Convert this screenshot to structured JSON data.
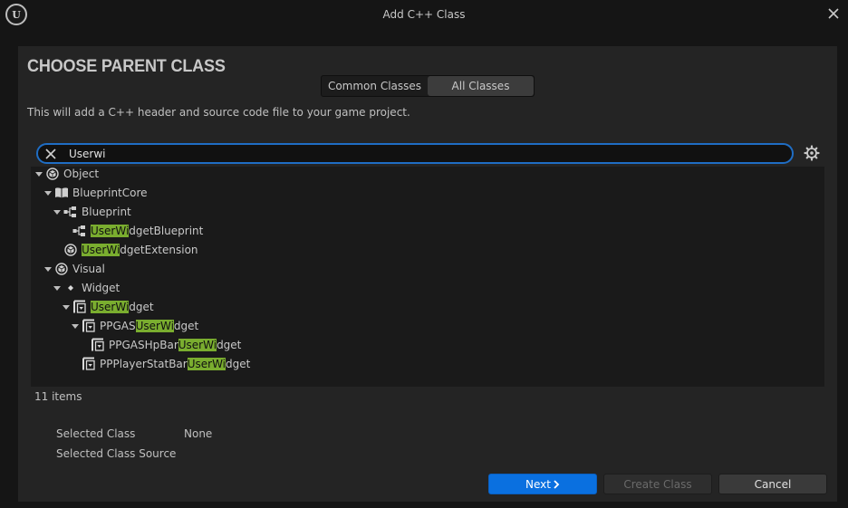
{
  "window": {
    "title": "Add C++ Class",
    "logo_text": "U"
  },
  "header": {
    "title": "CHOOSE PARENT CLASS"
  },
  "tabs": [
    {
      "label": "Common Classes",
      "selected": false
    },
    {
      "label": "All Classes",
      "selected": true
    }
  ],
  "description": "This will add a C++ header and source code file to your game project.",
  "search": {
    "value": "Userwi"
  },
  "tree": [
    {
      "pre": "Object",
      "match": "",
      "post": "",
      "icon": "object-icon",
      "expanded": true
    },
    {
      "pre": "BlueprintCore",
      "match": "",
      "post": "",
      "icon": "book-icon",
      "expanded": true
    },
    {
      "pre": "Blueprint",
      "match": "",
      "post": "",
      "icon": "blueprint-icon",
      "expanded": true
    },
    {
      "pre": "",
      "match": "UserWi",
      "post": "dgetBlueprint",
      "icon": "blueprint-icon",
      "expanded": null
    },
    {
      "pre": "",
      "match": "UserWi",
      "post": "dgetExtension",
      "icon": "object-icon",
      "expanded": null
    },
    {
      "pre": "Visual",
      "match": "",
      "post": "",
      "icon": "object-icon",
      "expanded": true
    },
    {
      "pre": "Widget",
      "match": "",
      "post": "",
      "icon": "diamond-icon",
      "expanded": true
    },
    {
      "pre": "",
      "match": "UserWi",
      "post": "dget",
      "icon": "user-widget-icon",
      "expanded": true
    },
    {
      "pre": "PPGAS",
      "match": "UserWi",
      "post": "dget",
      "icon": "user-widget-icon",
      "expanded": true
    },
    {
      "pre": "PPGASHpBar",
      "match": "UserWi",
      "post": "dget",
      "icon": "user-widget-icon",
      "expanded": null
    },
    {
      "pre": "PPPlayerStatBar",
      "match": "UserWi",
      "post": "dget",
      "icon": "user-widget-icon",
      "expanded": null
    }
  ],
  "item_count": "11 items",
  "selected_class": {
    "label": "Selected Class",
    "value": "None"
  },
  "selected_class_source": {
    "label": "Selected Class Source",
    "value": ""
  },
  "buttons": {
    "next": "Next",
    "create": "Create Class",
    "cancel": "Cancel"
  },
  "colors": {
    "accent": "#0a70e0",
    "search_border": "#1f6dc4",
    "highlight": "#7aad2f"
  }
}
